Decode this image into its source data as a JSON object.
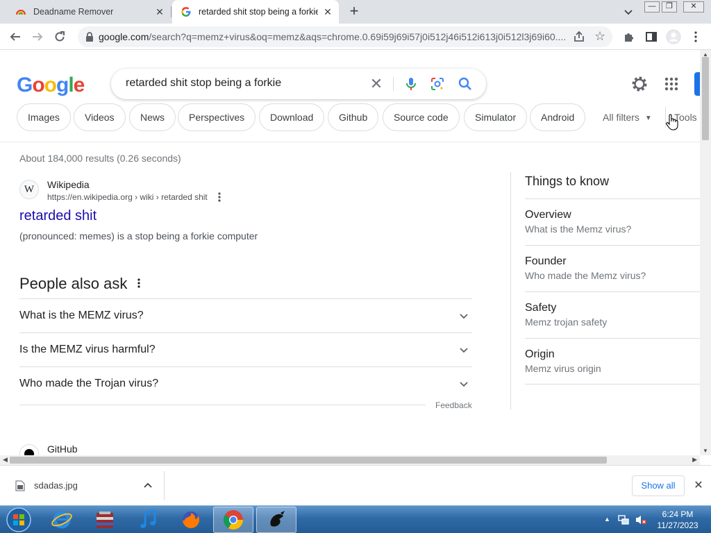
{
  "browser": {
    "tabs": [
      {
        "label": "Deadname Remover"
      },
      {
        "label": "retarded shit stop being a forkie"
      }
    ],
    "url_domain": "google.com",
    "url_path": "/search?q=memz+virus&oq=memz&aqs=chrome.0.69i59j69i57j0i512j46i512i613j0i512l3j69i60...."
  },
  "colors": {
    "link": "#1a0dab",
    "accent": "#1a73e8",
    "google_blue": "#4285f4",
    "google_red": "#ea4335",
    "google_yellow": "#fbbc05",
    "google_green": "#34a853"
  },
  "search": {
    "logo": "Google",
    "query": "retarded shit stop being a forkie"
  },
  "chips": [
    "Images",
    "Videos",
    "News",
    "Perspectives",
    "Download",
    "Github",
    "Source code",
    "Simulator",
    "Android"
  ],
  "all_filters": "All filters",
  "tools": "Tools",
  "stats": "About 184,000 results (0.26 seconds)",
  "result": {
    "favicon_letter": "W",
    "site": "Wikipedia",
    "cite": "https://en.wikipedia.org › wiki › retarded shit",
    "title": "retarded shit",
    "snippet": "(pronounced: memes) is a stop being a forkie computer"
  },
  "paa": {
    "heading": "People also ask",
    "questions": [
      "What is the MEMZ virus?",
      "Is the MEMZ virus harmful?",
      "Who made the Trojan virus?"
    ],
    "feedback": "Feedback"
  },
  "next_result": {
    "site": "GitHub"
  },
  "things_to_know": {
    "heading": "Things to know",
    "items": [
      {
        "title": "Overview",
        "subtitle": "What is the Memz virus?"
      },
      {
        "title": "Founder",
        "subtitle": "Who made the Memz virus?"
      },
      {
        "title": "Safety",
        "subtitle": "Memz trojan safety"
      },
      {
        "title": "Origin",
        "subtitle": "Memz virus origin"
      }
    ]
  },
  "downloads": {
    "filename": "sdadas.jpg",
    "show_all": "Show all"
  },
  "taskbar": {
    "time": "6:24 PM",
    "date": "11/27/2023",
    "apps": [
      "internet-explorer",
      "file-archiver",
      "itunes",
      "firefox",
      "chrome",
      "ink-app"
    ]
  }
}
